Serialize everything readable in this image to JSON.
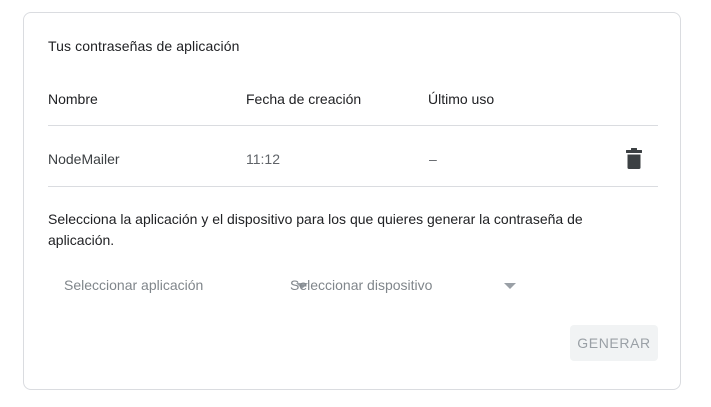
{
  "section_title": "Tus contraseñas de aplicación",
  "table": {
    "headers": {
      "name": "Nombre",
      "created": "Fecha de creación",
      "last_used": "Último uso"
    },
    "rows": [
      {
        "name": "NodeMailer",
        "created": "11:12",
        "last_used": "–",
        "action_icon": "trash-icon"
      }
    ]
  },
  "instructions": "Selecciona la aplicación y el dispositivo para los que quieres generar la contraseña de aplicación.",
  "selects": {
    "app_placeholder": "Seleccionar aplicación",
    "device_placeholder": "Seleccionar dispositivo"
  },
  "generate_button": "GENERAR",
  "colors": {
    "border": "#dadce0",
    "text_primary": "#202124",
    "text_secondary": "#5f6368",
    "placeholder": "#80868b",
    "button_disabled_bg": "#f1f3f4",
    "button_disabled_text": "#9aa0a6"
  }
}
